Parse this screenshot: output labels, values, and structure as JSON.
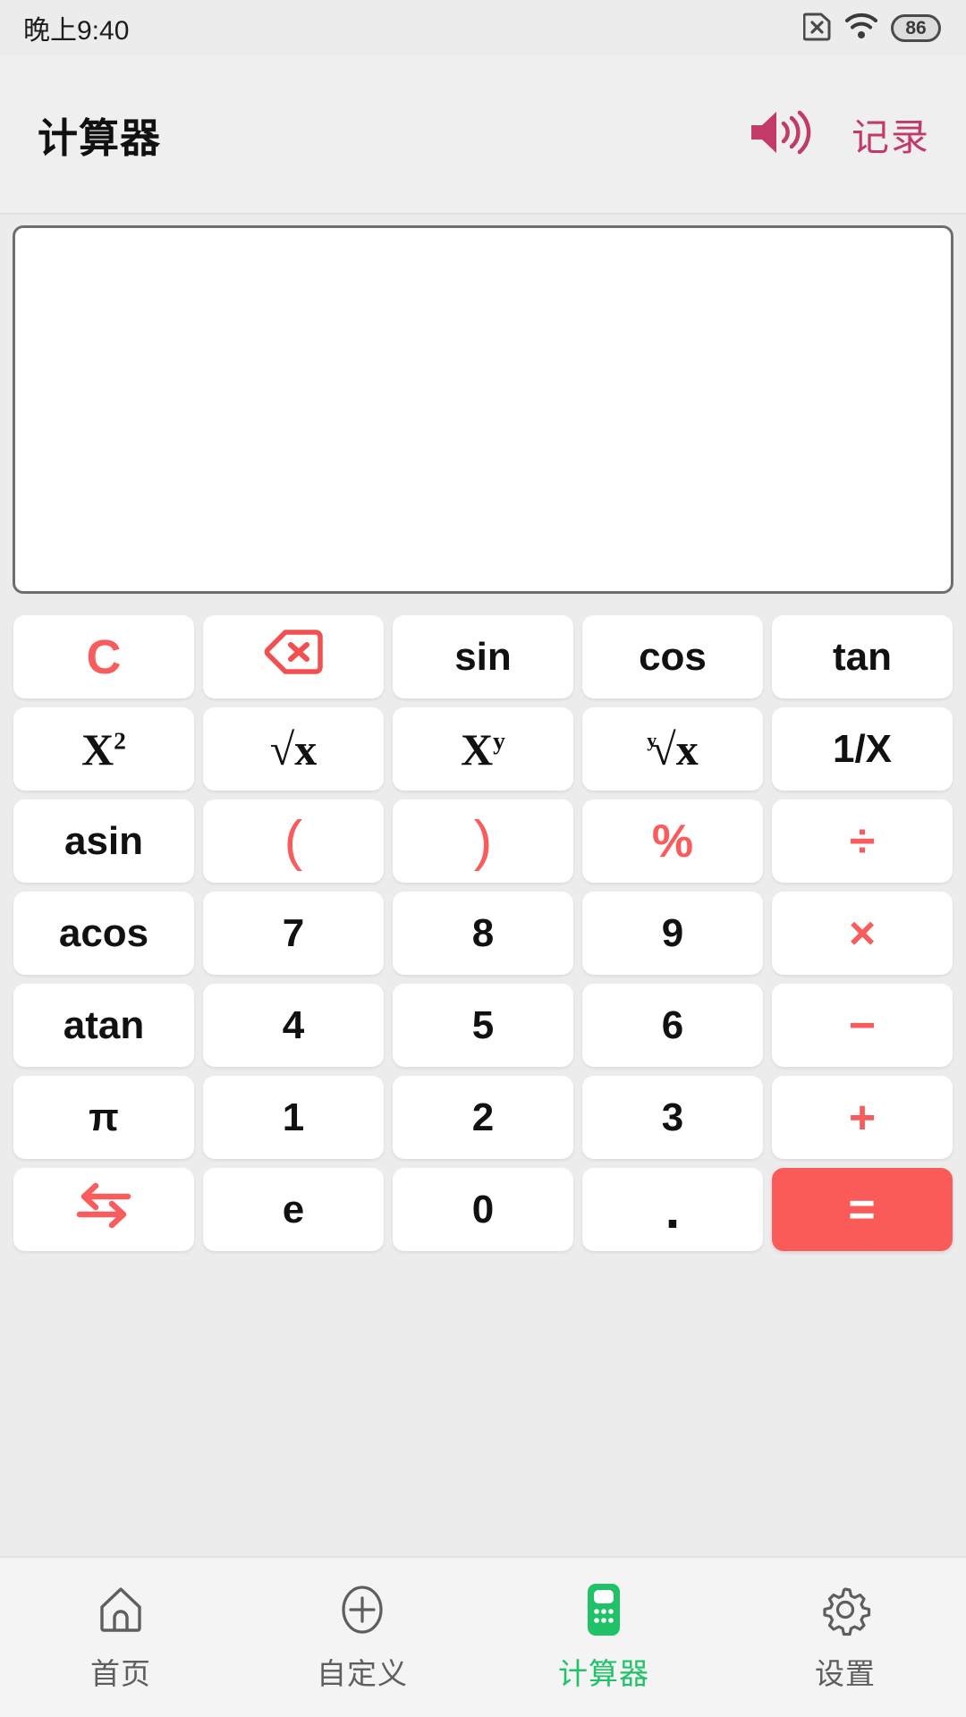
{
  "statusbar": {
    "time": "晚上9:40",
    "sim_icon": "sim-card-off-icon",
    "wifi_icon": "wifi-icon",
    "battery_level": "86"
  },
  "header": {
    "title": "计算器",
    "sound_icon": "speaker-volume-icon",
    "record_label": "记录",
    "accent_color": "#c23a68"
  },
  "display": {
    "value": "",
    "placeholder": ""
  },
  "keypad": {
    "accent_red": "#f85c5c",
    "equals_bg": "#fa5a58",
    "rows": [
      [
        {
          "label": "C",
          "name": "clear-button",
          "style": "red"
        },
        {
          "label": "",
          "name": "backspace-button",
          "style": "icon-backspace"
        },
        {
          "label": "sin",
          "name": "sin-button",
          "style": "plain"
        },
        {
          "label": "cos",
          "name": "cos-button",
          "style": "plain"
        },
        {
          "label": "tan",
          "name": "tan-button",
          "style": "plain"
        }
      ],
      [
        {
          "label": "X2",
          "name": "x-squared-button",
          "style": "sup",
          "base": "X",
          "sup": "2"
        },
        {
          "label": "√x",
          "name": "square-root-button",
          "style": "radical",
          "index": "",
          "body": "√x"
        },
        {
          "label": "Xy",
          "name": "x-power-y-button",
          "style": "sup",
          "base": "X",
          "sup": "y"
        },
        {
          "label": "y√x",
          "name": "nth-root-button",
          "style": "radical",
          "index": "y",
          "body": "√x"
        },
        {
          "label": "1/X",
          "name": "reciprocal-button",
          "style": "plain"
        }
      ],
      [
        {
          "label": "asin",
          "name": "asin-button",
          "style": "plain"
        },
        {
          "label": "(",
          "name": "open-paren-button",
          "style": "red-paren"
        },
        {
          "label": ")",
          "name": "close-paren-button",
          "style": "red-paren"
        },
        {
          "label": "%",
          "name": "percent-button",
          "style": "red-op"
        },
        {
          "label": "÷",
          "name": "divide-button",
          "style": "red-op"
        }
      ],
      [
        {
          "label": "acos",
          "name": "acos-button",
          "style": "plain"
        },
        {
          "label": "7",
          "name": "digit-7-button",
          "style": "plain"
        },
        {
          "label": "8",
          "name": "digit-8-button",
          "style": "plain"
        },
        {
          "label": "9",
          "name": "digit-9-button",
          "style": "plain"
        },
        {
          "label": "×",
          "name": "multiply-button",
          "style": "red-op"
        }
      ],
      [
        {
          "label": "atan",
          "name": "atan-button",
          "style": "plain"
        },
        {
          "label": "4",
          "name": "digit-4-button",
          "style": "plain"
        },
        {
          "label": "5",
          "name": "digit-5-button",
          "style": "plain"
        },
        {
          "label": "6",
          "name": "digit-6-button",
          "style": "plain"
        },
        {
          "label": "−",
          "name": "minus-button",
          "style": "red-op"
        }
      ],
      [
        {
          "label": "π",
          "name": "pi-button",
          "style": "plain"
        },
        {
          "label": "1",
          "name": "digit-1-button",
          "style": "plain"
        },
        {
          "label": "2",
          "name": "digit-2-button",
          "style": "plain"
        },
        {
          "label": "3",
          "name": "digit-3-button",
          "style": "plain"
        },
        {
          "label": "+",
          "name": "plus-button",
          "style": "red-op"
        }
      ],
      [
        {
          "label": "",
          "name": "swap-button",
          "style": "icon-swap"
        },
        {
          "label": "e",
          "name": "euler-e-button",
          "style": "plain"
        },
        {
          "label": "0",
          "name": "digit-0-button",
          "style": "plain"
        },
        {
          "label": ".",
          "name": "decimal-point-button",
          "style": "dot"
        },
        {
          "label": "=",
          "name": "equals-button",
          "style": "equals"
        }
      ]
    ]
  },
  "navbar": {
    "active_color": "#1fc266",
    "items": [
      {
        "label": "首页",
        "name": "nav-home",
        "icon": "home-icon",
        "active": false
      },
      {
        "label": "自定义",
        "name": "nav-custom",
        "icon": "plus-circle-icon",
        "active": false
      },
      {
        "label": "计算器",
        "name": "nav-calculator",
        "icon": "calculator-icon",
        "active": true
      },
      {
        "label": "设置",
        "name": "nav-settings",
        "icon": "gear-icon",
        "active": false
      }
    ]
  }
}
